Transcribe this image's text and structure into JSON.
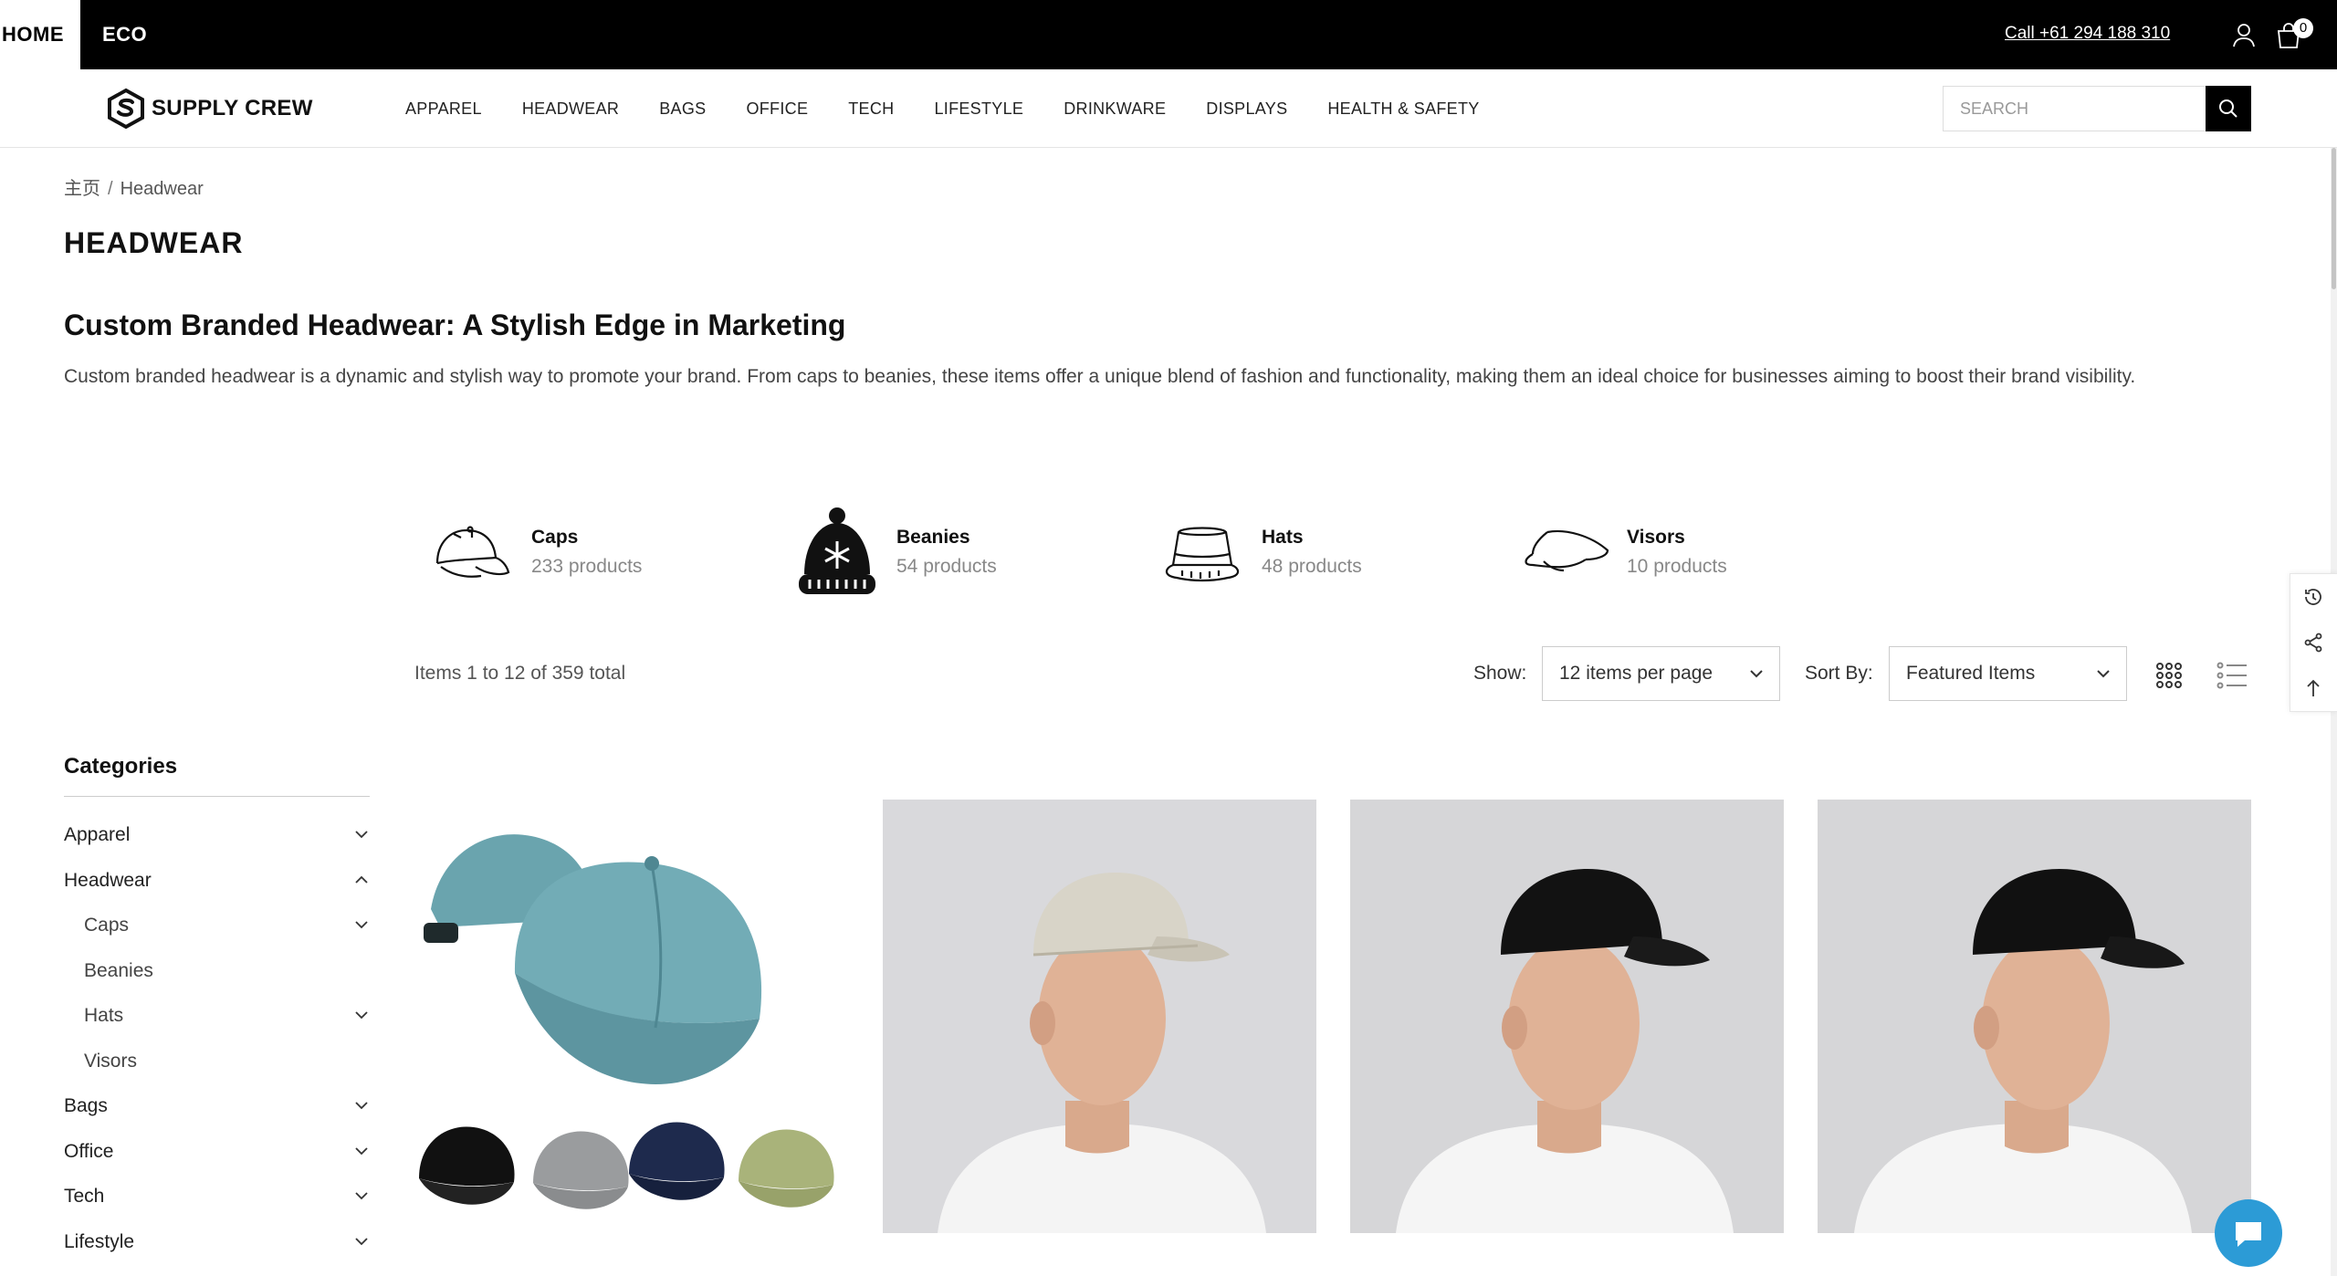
{
  "topbar": {
    "tabs": [
      "HOME",
      "ECO"
    ],
    "phone": "Call +61 294 188 310",
    "cart_count": "0"
  },
  "header": {
    "logo_text": "SUPPLY CREW",
    "menu": [
      "APPAREL",
      "HEADWEAR",
      "BAGS",
      "OFFICE",
      "TECH",
      "LIFESTYLE",
      "DRINKWARE",
      "DISPLAYS",
      "HEALTH & SAFETY"
    ],
    "search_placeholder": "SEARCH"
  },
  "breadcrumb": {
    "home": "主页",
    "separator": "/",
    "current": "Headwear"
  },
  "page": {
    "title": "HEADWEAR",
    "headline": "Custom Branded Headwear: A Stylish Edge in Marketing",
    "intro": "Custom branded headwear is a dynamic and stylish way to promote your brand. From caps to beanies, these items offer a unique blend of fashion and functionality, making them an ideal choice for businesses aiming to boost their brand visibility."
  },
  "subcategories": [
    {
      "name": "Caps",
      "count": "233 products",
      "icon": "cap-icon"
    },
    {
      "name": "Beanies",
      "count": "54 products",
      "icon": "beanie-icon"
    },
    {
      "name": "Hats",
      "count": "48 products",
      "icon": "bucket-hat-icon"
    },
    {
      "name": "Visors",
      "count": "10 products",
      "icon": "visor-icon"
    }
  ],
  "toolbar": {
    "items_total": "Items 1 to 12 of 359 total",
    "show_label": "Show:",
    "show_value": "12 items per page",
    "sort_label": "Sort By:",
    "sort_value": "Featured Items"
  },
  "sidebar": {
    "title": "Categories",
    "items": [
      {
        "label": "Apparel",
        "level": 1,
        "chevron": "down"
      },
      {
        "label": "Headwear",
        "level": 1,
        "chevron": "up"
      },
      {
        "label": "Caps",
        "level": 2,
        "chevron": "down"
      },
      {
        "label": "Beanies",
        "level": 2,
        "chevron": "none"
      },
      {
        "label": "Hats",
        "level": 2,
        "chevron": "down"
      },
      {
        "label": "Visors",
        "level": 2,
        "chevron": "none"
      },
      {
        "label": "Bags",
        "level": 1,
        "chevron": "down"
      },
      {
        "label": "Office",
        "level": 1,
        "chevron": "down"
      },
      {
        "label": "Tech",
        "level": 1,
        "chevron": "down"
      },
      {
        "label": "Lifestyle",
        "level": 1,
        "chevron": "down"
      }
    ]
  },
  "products": [
    {
      "image": "teal-cap-with-color-variants"
    },
    {
      "image": "model-wearing-beige-cap"
    },
    {
      "image": "model-wearing-black-cap"
    },
    {
      "image": "model-wearing-black-cap-side"
    }
  ],
  "colors": {
    "topbar_bg": "#000000",
    "chat_blue": "#2c9bd6",
    "teal_cap": "#6aa4ae"
  }
}
